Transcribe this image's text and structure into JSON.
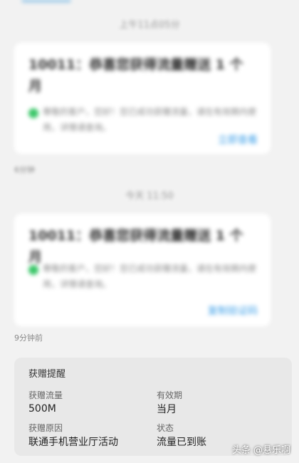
{
  "messages": [
    {
      "time_label": "上午11点05分",
      "title": "10011：恭喜您获得流量赠送 1 个月",
      "body": "尊敬的客户，您好！您已成功获赠流量，请在有效期内使用，详情请查询。",
      "link": "立即查看"
    },
    {
      "time_label": "今天 11:50",
      "title": "10011：恭喜您获得流量赠送 1 个月",
      "body": "尊敬的客户，您好！您已成功获赠流量，请在有效期内使用，详情请查询。",
      "link": "复制验证码"
    }
  ],
  "timestamps": {
    "first_small": "6分钟",
    "second_small": "9分钟前"
  },
  "gift": {
    "heading": "获赠提醒",
    "amount_label": "获赠流量",
    "amount_value": "500M",
    "validity_label": "有效期",
    "validity_value": "当月",
    "reason_label": "获赠原因",
    "reason_value": "联通手机营业厅活动",
    "status_label": "状态",
    "status_value": "流量已到账"
  },
  "watermark": "头条 @悬乐啊",
  "colors": {
    "accent_link": "#3a9ee8",
    "check_green": "#3cc76a"
  }
}
